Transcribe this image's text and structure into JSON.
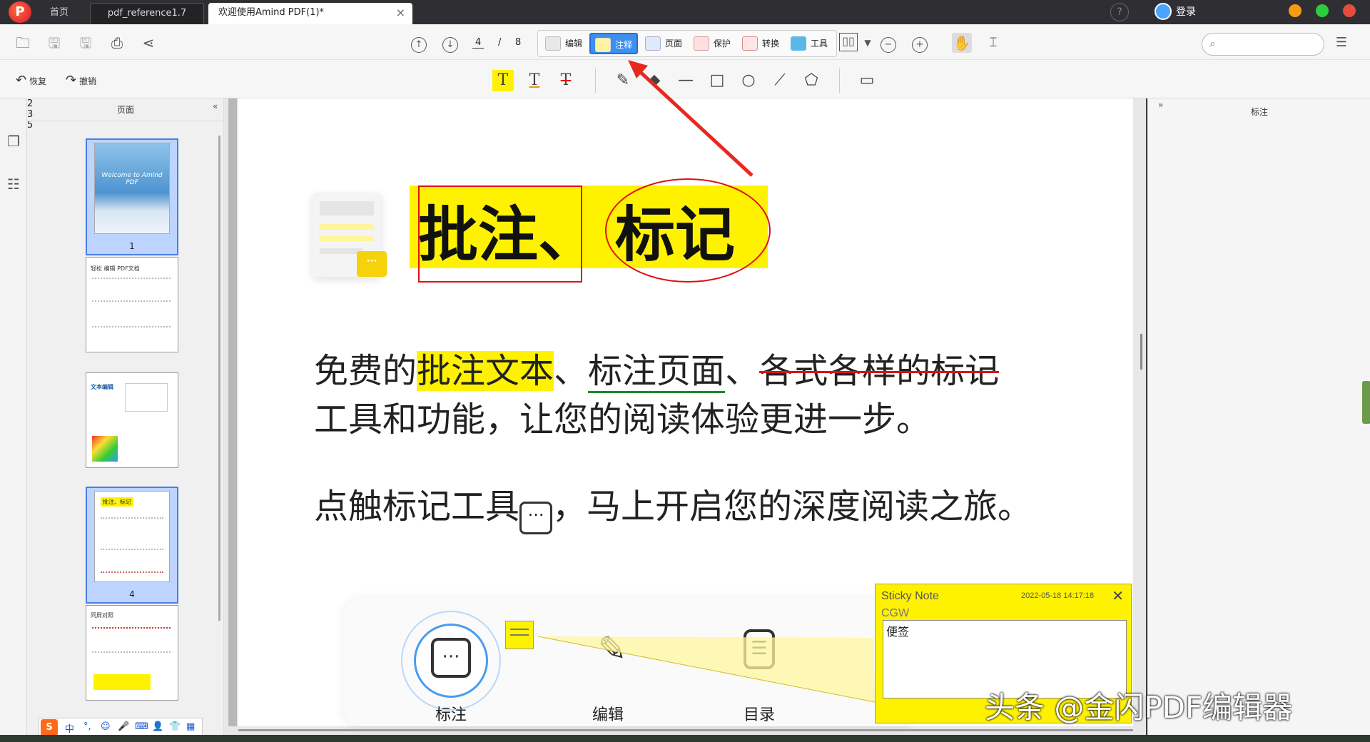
{
  "titlebar": {
    "logo": "P",
    "tabs": [
      "首页",
      "pdf_reference1.7",
      "欢迎使用Amind PDF(1)*"
    ],
    "help": "?",
    "login": "登录",
    "window_colors": [
      "#f39c12",
      "#2ecc40",
      "#e74c3c"
    ]
  },
  "toolbar": {
    "page_current": "4",
    "page_sep": "/",
    "page_total": "8",
    "modes": [
      "编辑",
      "注释",
      "页面",
      "保护",
      "转换",
      "工具"
    ],
    "active_mode": "注释",
    "icons": [
      "folder-icon",
      "save-icon",
      "save-as-icon",
      "print-icon",
      "share-icon",
      "prev-page-icon",
      "next-page-icon",
      "view-mode-icon",
      "zoom-out-icon",
      "zoom-in-icon",
      "hand-icon",
      "select-icon",
      "search-icon",
      "menu-icon"
    ]
  },
  "annotbar": {
    "undo": "恢复",
    "redo": "撤销",
    "tools": [
      "highlight-text-icon",
      "underline-text-icon",
      "strikethrough-text-icon",
      "pencil-icon",
      "eraser-icon",
      "line-icon",
      "rectangle-icon",
      "circle-icon",
      "polyline-icon",
      "polygon-icon",
      "sticky-note-icon"
    ]
  },
  "left_panel": {
    "title": "页面",
    "collapse": "«",
    "thumbnails": [
      {
        "num": "1",
        "caption": "Welcome to Amind PDF"
      },
      {
        "num": "2",
        "caption": "轻松 编辑 PDF文档"
      },
      {
        "num": "3",
        "caption": "文本编辑"
      },
      {
        "num": "4",
        "caption": "批注、标记"
      },
      {
        "num": "5",
        "caption": "同屏对照"
      }
    ],
    "selected": "4"
  },
  "right_panel": {
    "title": "标注",
    "expand": "»"
  },
  "document": {
    "title_part1": "批注、",
    "title_part2": "标记",
    "line1_pre": "免费的",
    "line1_hl": "批注文本",
    "line1_mid": "、",
    "line1_ul": "标注页面",
    "line1_mid2": "、",
    "line1_strike": "各式各样的标记",
    "line2": "工具和功能，让您的阅读体验更进一步。",
    "line3_pre": "点触标记工具",
    "line3_post": "，马上开启您的深度阅读之旅。",
    "card": {
      "items": [
        "标注",
        "编辑",
        "目录"
      ]
    }
  },
  "sticky_note": {
    "title": "Sticky Note",
    "date": "2022-05-18 14:17:18",
    "author": "CGW",
    "body": "便签",
    "close": "✕"
  },
  "watermark": "头条 @金闪PDF编辑器",
  "ime": {
    "items": [
      "中",
      "°,",
      "☺",
      "🎤",
      "⌨",
      "👤",
      "👕",
      "▦"
    ]
  },
  "colors": {
    "highlight": "#fff200",
    "accent": "#3d8ff0",
    "annotation_red": "#e01010",
    "underline_green": "#1a8a2a"
  }
}
